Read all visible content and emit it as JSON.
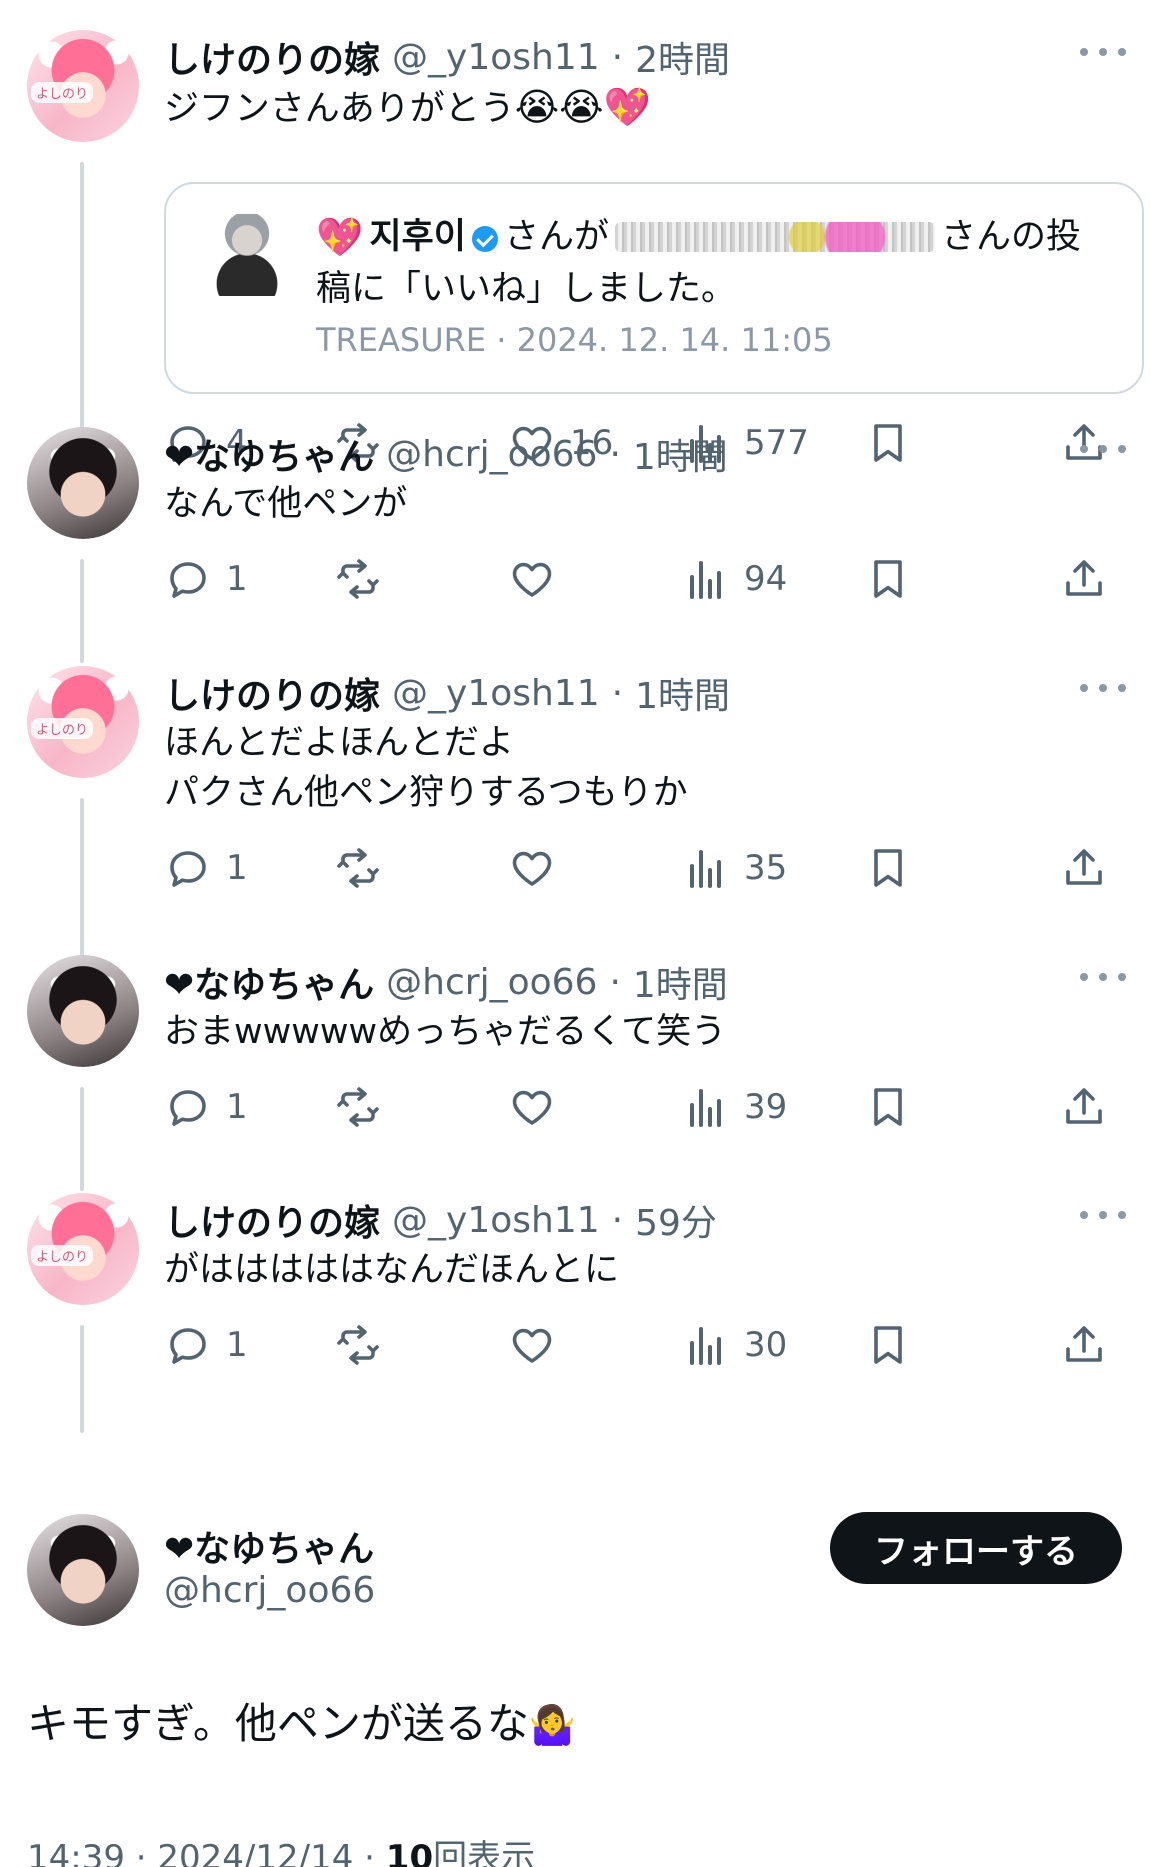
{
  "tweets": [
    {
      "name": "しけのりの嫁",
      "handle": "@_y1osh11",
      "time": "2時間",
      "text_lines": [
        "ジフンさんありがとう"
      ],
      "emojis": "😭😭💖",
      "quote": {
        "heart": "💖",
        "name": "지후이",
        "pre": "さんが",
        "post": "さんの投",
        "line2": "稿に「いいね」しました。",
        "line3": "TREASURE · 2024. 12. 14. 11:05"
      },
      "replies": "4",
      "likes": "16",
      "views": "577"
    },
    {
      "name": "❤なゆちゃん",
      "handle": "@hcrj_oo66",
      "time": "1時間",
      "text_lines": [
        "なんで他ペンが"
      ],
      "replies": "1",
      "likes": "",
      "views": "94"
    },
    {
      "name": "しけのりの嫁",
      "handle": "@_y1osh11",
      "time": "1時間",
      "text_lines": [
        "ほんとだよほんとだよ",
        "パクさん他ペン狩りするつもりか"
      ],
      "replies": "1",
      "likes": "",
      "views": "35"
    },
    {
      "name": "❤なゆちゃん",
      "handle": "@hcrj_oo66",
      "time": "1時間",
      "text_lines": [
        "おまwwwwwめっちゃだるくて笑う"
      ],
      "replies": "1",
      "likes": "",
      "views": "39"
    },
    {
      "name": "しけのりの嫁",
      "handle": "@_y1osh11",
      "time": "59分",
      "text_lines": [
        "がはははははなんだほんとに"
      ],
      "replies": "1",
      "likes": "",
      "views": "30"
    }
  ],
  "avatar_tag": "よしのり",
  "main": {
    "name": "❤なゆちゃん",
    "handle": "@hcrj_oo66",
    "follow_label": "フォローする",
    "text": "キモすぎ。他ペンが送るな",
    "emoji": "🤷‍♀️",
    "timestamp": "14:39 · 2024/12/14 · ",
    "view_count": "10",
    "view_label": "回表示"
  },
  "colors": {
    "text": "#0f1419",
    "muted": "#536471",
    "border": "#cfd9de",
    "button_bg": "#0f1419"
  }
}
